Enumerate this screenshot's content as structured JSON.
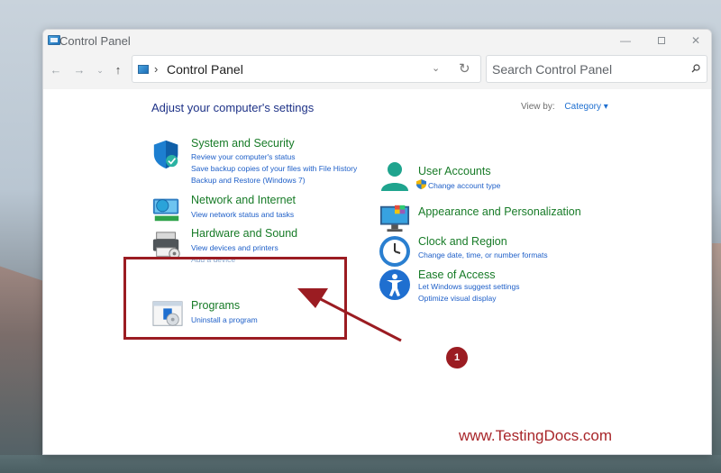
{
  "window": {
    "title": "Control Panel",
    "controls": {
      "minimize": "—",
      "close": "✕"
    }
  },
  "nav": {
    "back": "←",
    "forward": "→",
    "recent": "⌄",
    "up": "↑",
    "address_chevron": "›",
    "address_text": "Control Panel",
    "address_dropdown": "⌄",
    "refresh": "↻",
    "search_placeholder": "Search Control Panel"
  },
  "content": {
    "heading": "Adjust your computer's settings",
    "view_by_label": "View by:",
    "view_by_value": "Category ▾"
  },
  "categories_left": [
    {
      "title": "System and Security",
      "icon": "shield-icon",
      "links": [
        "Review your computer's status",
        "Save backup copies of your files with File History",
        "Backup and Restore (Windows 7)"
      ]
    },
    {
      "title": "Network and Internet",
      "icon": "network-globe-icon",
      "links": [
        "View network status and tasks"
      ]
    },
    {
      "title": "Hardware and Sound",
      "icon": "printer-icon",
      "links": [
        "View devices and printers",
        "Add a device"
      ]
    },
    {
      "title": "Programs",
      "icon": "programs-icon",
      "links": [
        "Uninstall a program"
      ]
    }
  ],
  "categories_right": [
    {
      "title": "User Accounts",
      "icon": "user-icon",
      "links": [
        "Change account type"
      ]
    },
    {
      "title": "Appearance and Personalization",
      "icon": "monitor-icon",
      "links": []
    },
    {
      "title": "Clock and Region",
      "icon": "clock-icon",
      "links": [
        "Change date, time, or number formats"
      ]
    },
    {
      "title": "Ease of Access",
      "icon": "accessibility-icon",
      "links": [
        "Let Windows suggest settings",
        "Optimize visual display"
      ]
    }
  ],
  "annotation": {
    "badge": "1",
    "watermark": "www.TestingDocs.com"
  },
  "colors": {
    "category_title": "#177b27",
    "link": "#1e5fc8",
    "heading": "#1e3287",
    "annotation": "#9b1c22"
  }
}
